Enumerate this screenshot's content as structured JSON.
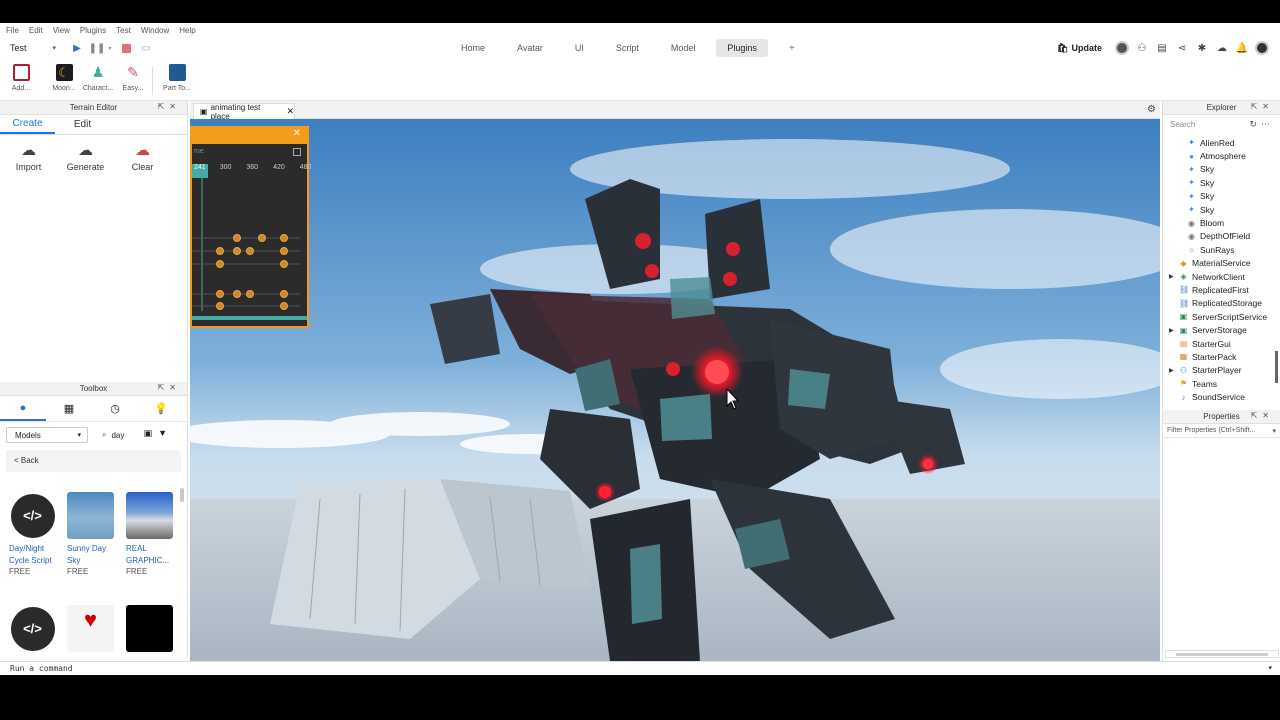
{
  "menu": [
    "File",
    "Edit",
    "View",
    "Plugins",
    "Test",
    "Window",
    "Help"
  ],
  "toolbar": {
    "mode": "Test",
    "tabs": [
      "Home",
      "Avatar",
      "UI",
      "Script",
      "Model",
      "Plugins"
    ],
    "active_tab": "Plugins",
    "add_tab": "+",
    "update_label": "Update"
  },
  "ribbon": {
    "items": [
      "Add...",
      "Moon...",
      "Charact...",
      "Easy...",
      "Part To..."
    ]
  },
  "terrain_editor": {
    "title": "Terrain Editor",
    "tabs": [
      "Create",
      "Edit"
    ],
    "tools": [
      "Import",
      "Generate",
      "Clear"
    ]
  },
  "toolbox": {
    "title": "Toolbox",
    "category": "Models",
    "search_value": "day",
    "back_label": "< Back",
    "assets": [
      {
        "name": "Day/Night Cycle Script",
        "price": "FREE"
      },
      {
        "name": "Sunny Day Sky",
        "price": "FREE"
      },
      {
        "name": "REAL GRAPHIC...",
        "price": "FREE"
      }
    ]
  },
  "document": {
    "tab_title": "animating test place"
  },
  "animation_editor": {
    "name_placeholder": "me",
    "ruler": [
      "241",
      "300",
      "360",
      "420",
      "480"
    ]
  },
  "explorer": {
    "title": "Explorer",
    "search_placeholder": "Search",
    "items": [
      {
        "label": "AlienRed",
        "indent": 2,
        "icon": "particle"
      },
      {
        "label": "Atmosphere",
        "indent": 2,
        "icon": "atmosphere"
      },
      {
        "label": "Sky",
        "indent": 2,
        "icon": "sky"
      },
      {
        "label": "Sky",
        "indent": 2,
        "icon": "sky"
      },
      {
        "label": "Sky",
        "indent": 2,
        "icon": "sky"
      },
      {
        "label": "Sky",
        "indent": 2,
        "icon": "sky"
      },
      {
        "label": "Bloom",
        "indent": 2,
        "icon": "effect"
      },
      {
        "label": "DepthOfField",
        "indent": 2,
        "icon": "effect"
      },
      {
        "label": "SunRays",
        "indent": 2,
        "icon": "sunrays"
      },
      {
        "label": "MaterialService",
        "indent": 1,
        "icon": "material"
      },
      {
        "label": "NetworkClient",
        "indent": 1,
        "icon": "network",
        "arrow": true
      },
      {
        "label": "ReplicatedFirst",
        "indent": 1,
        "icon": "replicated"
      },
      {
        "label": "ReplicatedStorage",
        "indent": 1,
        "icon": "replicated"
      },
      {
        "label": "ServerScriptService",
        "indent": 1,
        "icon": "server"
      },
      {
        "label": "ServerStorage",
        "indent": 1,
        "icon": "server",
        "arrow": true
      },
      {
        "label": "StarterGui",
        "indent": 1,
        "icon": "gui"
      },
      {
        "label": "StarterPack",
        "indent": 1,
        "icon": "pack"
      },
      {
        "label": "StarterPlayer",
        "indent": 1,
        "icon": "player",
        "arrow": true
      },
      {
        "label": "Teams",
        "indent": 1,
        "icon": "teams"
      },
      {
        "label": "SoundService",
        "indent": 1,
        "icon": "sound"
      }
    ]
  },
  "properties": {
    "title": "Properties",
    "filter_placeholder": "Filter Properties (Ctrl+Shift..."
  },
  "command_bar": {
    "placeholder": "Run a command"
  }
}
